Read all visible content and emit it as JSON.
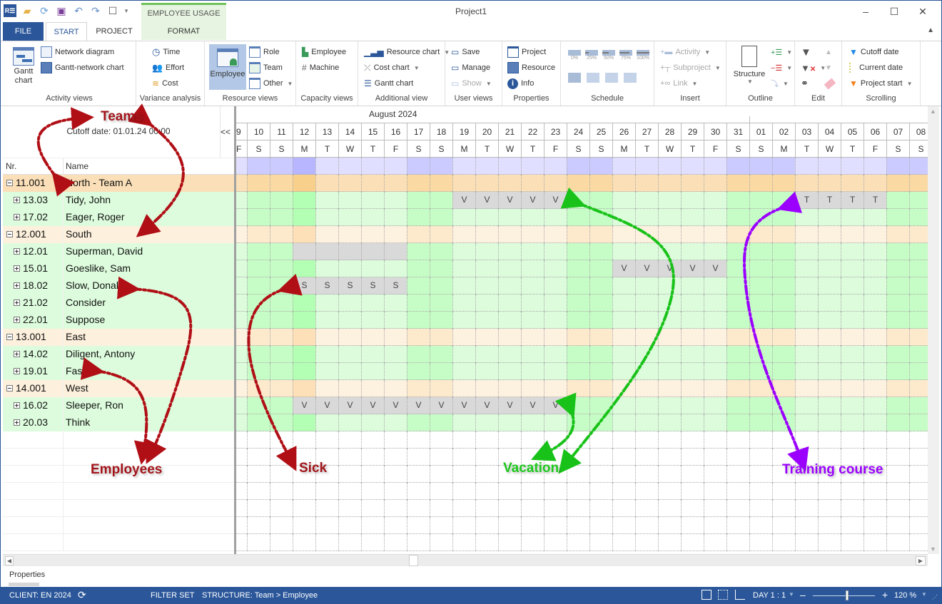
{
  "window": {
    "title": "Project1",
    "context_tab_group": "EMPLOYEE USAGE",
    "controls": [
      "minimize",
      "maximize",
      "close"
    ]
  },
  "quick_access": [
    "app-logo",
    "open-folder",
    "refresh",
    "save",
    "undo",
    "redo",
    "window-layout",
    "customize"
  ],
  "tabs": [
    {
      "label": "FILE",
      "active": false
    },
    {
      "label": "START",
      "active": true
    },
    {
      "label": "PROJECT",
      "active": false
    },
    {
      "label": "FORMAT",
      "active": false
    }
  ],
  "ribbon": {
    "activity_views": {
      "label": "Activity views",
      "gantt": "Gantt chart",
      "network": "Network diagram",
      "gantt_network": "Gantt-network chart"
    },
    "variance": {
      "label": "Variance analysis",
      "time": "Time",
      "effort": "Effort",
      "cost": "Cost"
    },
    "resource_views": {
      "label": "Resource views",
      "employee": "Employee",
      "role": "Role",
      "team": "Team",
      "other": "Other"
    },
    "capacity_views": {
      "label": "Capacity views",
      "employee": "Employee",
      "machine": "Machine"
    },
    "additional": {
      "label": "Additional view",
      "resource_chart": "Resource chart",
      "cost_chart": "Cost chart",
      "gantt_chart": "Gantt chart"
    },
    "user_views": {
      "label": "User views",
      "save": "Save",
      "manage": "Manage",
      "show": "Show"
    },
    "properties": {
      "label": "Properties",
      "project": "Project",
      "resource": "Resource",
      "info": "Info"
    },
    "schedule": {
      "label": "Schedule",
      "percents": [
        "0%",
        "25%",
        "50%",
        "75%",
        "100%"
      ]
    },
    "insert": {
      "label": "Insert",
      "activity": "Activity",
      "subproject": "Subproject",
      "link": "Link"
    },
    "outline": {
      "label": "Outline",
      "structure": "Structure"
    },
    "edit": {
      "label": "Edit"
    },
    "scrolling": {
      "label": "Scrolling",
      "cutoff": "Cutoff date",
      "current": "Current date",
      "project_start": "Project start"
    }
  },
  "left_pane": {
    "cutoff_text": "Cutoff date: 01.01.24 00:00",
    "collapse_toggle": "<<",
    "columns": {
      "nr": "Nr.",
      "name": "Name"
    },
    "rows": [
      {
        "nr": "11.001",
        "name": "North - Team A",
        "type": "team"
      },
      {
        "nr": "13.03",
        "name": "Tidy, John",
        "type": "employee"
      },
      {
        "nr": "17.02",
        "name": "Eager, Roger",
        "type": "employee"
      },
      {
        "nr": "12.001",
        "name": "South",
        "type": "team"
      },
      {
        "nr": "12.01",
        "name": "Superman, David",
        "type": "employee"
      },
      {
        "nr": "15.01",
        "name": "Goeslike, Sam",
        "type": "employee"
      },
      {
        "nr": "18.02",
        "name": "Slow, Donald",
        "type": "employee"
      },
      {
        "nr": "21.02",
        "name": "Consider",
        "type": "employee"
      },
      {
        "nr": "22.01",
        "name": "Suppose",
        "type": "employee"
      },
      {
        "nr": "13.001",
        "name": "East",
        "type": "team"
      },
      {
        "nr": "14.02",
        "name": "Diligent, Antony",
        "type": "employee"
      },
      {
        "nr": "19.01",
        "name": "Fast",
        "type": "employee"
      },
      {
        "nr": "14.001",
        "name": "West",
        "type": "team"
      },
      {
        "nr": "16.02",
        "name": "Sleeper, Ron",
        "type": "employee"
      },
      {
        "nr": "20.03",
        "name": "Think",
        "type": "employee"
      }
    ]
  },
  "timeline": {
    "month": "August 2024",
    "partial_first": {
      "day": "9",
      "dow": "F"
    },
    "days": [
      {
        "d": "10",
        "w": "S",
        "we": true
      },
      {
        "d": "11",
        "w": "S",
        "we": true
      },
      {
        "d": "12",
        "w": "M",
        "hol": true
      },
      {
        "d": "13",
        "w": "T"
      },
      {
        "d": "14",
        "w": "W"
      },
      {
        "d": "15",
        "w": "T"
      },
      {
        "d": "16",
        "w": "F"
      },
      {
        "d": "17",
        "w": "S",
        "we": true
      },
      {
        "d": "18",
        "w": "S",
        "we": true
      },
      {
        "d": "19",
        "w": "M"
      },
      {
        "d": "20",
        "w": "T"
      },
      {
        "d": "21",
        "w": "W"
      },
      {
        "d": "22",
        "w": "T"
      },
      {
        "d": "23",
        "w": "F"
      },
      {
        "d": "24",
        "w": "S",
        "we": true
      },
      {
        "d": "25",
        "w": "S",
        "we": true
      },
      {
        "d": "26",
        "w": "M"
      },
      {
        "d": "27",
        "w": "T"
      },
      {
        "d": "28",
        "w": "W"
      },
      {
        "d": "29",
        "w": "T"
      },
      {
        "d": "30",
        "w": "F"
      },
      {
        "d": "31",
        "w": "S",
        "we": true
      },
      {
        "d": "01",
        "w": "S",
        "we": true
      },
      {
        "d": "02",
        "w": "M",
        "we": true
      },
      {
        "d": "03",
        "w": "T"
      },
      {
        "d": "04",
        "w": "W"
      },
      {
        "d": "05",
        "w": "T"
      },
      {
        "d": "06",
        "w": "F"
      },
      {
        "d": "07",
        "w": "S",
        "we": true
      },
      {
        "d": "08",
        "w": "S",
        "we": true
      }
    ],
    "absences": [
      {
        "row": 1,
        "from": "19",
        "to": "23",
        "code": "V"
      },
      {
        "row": 1,
        "from": "03",
        "to": "06",
        "code": "T"
      },
      {
        "row": 4,
        "from": "12",
        "to": "16",
        "code": ""
      },
      {
        "row": 5,
        "from": "26",
        "to": "30",
        "code": "V"
      },
      {
        "row": 6,
        "from": "12",
        "to": "16",
        "code": "S"
      },
      {
        "row": 13,
        "from": "12",
        "to": "23",
        "code": "V"
      }
    ]
  },
  "annotations": {
    "teams": "Teams",
    "employees": "Employees",
    "sick": "Sick",
    "vacation": "Vacation",
    "training": "Training course"
  },
  "colors": {
    "accent": "#2b579a",
    "team_row": "#fdf0dd",
    "employee_row": "#ddfcdd",
    "absence": "#d9d9d9",
    "teams_annot": "#a3151b",
    "vacation_annot": "#1ec81e",
    "training_annot": "#9b00ff"
  },
  "properties_panel": {
    "label": "Properties"
  },
  "status": {
    "client": "CLIENT: EN 2024",
    "filter": "FILTER SET",
    "structure": "STRUCTURE: Team > Employee",
    "scale": "DAY 1 : 1",
    "zoom": "120 %",
    "zoom_percent": 120
  }
}
